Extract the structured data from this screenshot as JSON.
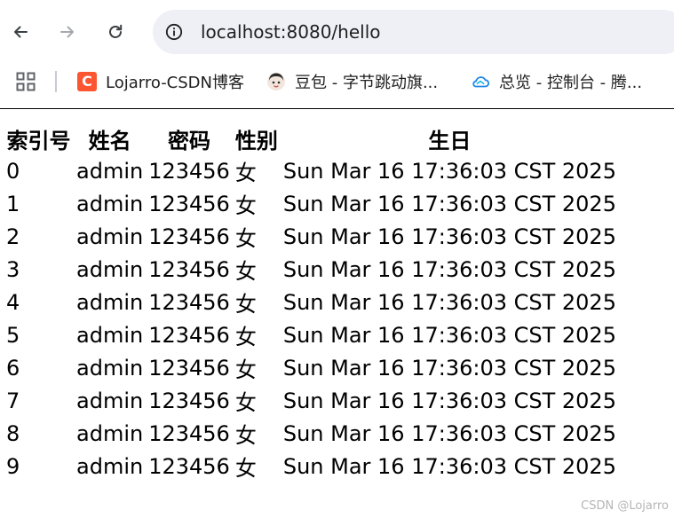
{
  "toolbar": {
    "back_icon": "arrow-left-icon",
    "forward_icon": "arrow-right-icon",
    "reload_icon": "reload-icon",
    "site_info_icon": "info-icon",
    "url": "localhost:8080/hello"
  },
  "bookmarks": [
    {
      "label": "Lojarro-CSDN博客",
      "icon": "csdn-icon"
    },
    {
      "label": "豆包 - 字节跳动旗...",
      "icon": "doubao-avatar-icon"
    },
    {
      "label": "总览 - 控制台 - 腾...",
      "icon": "tencent-cloud-icon"
    }
  ],
  "table": {
    "headers": [
      "索引号",
      "姓名",
      "密码",
      "性别",
      "生日"
    ],
    "rows": [
      [
        "0",
        "admin",
        "123456",
        "女",
        "Sun Mar 16 17:36:03 CST 2025"
      ],
      [
        "1",
        "admin",
        "123456",
        "女",
        "Sun Mar 16 17:36:03 CST 2025"
      ],
      [
        "2",
        "admin",
        "123456",
        "女",
        "Sun Mar 16 17:36:03 CST 2025"
      ],
      [
        "3",
        "admin",
        "123456",
        "女",
        "Sun Mar 16 17:36:03 CST 2025"
      ],
      [
        "4",
        "admin",
        "123456",
        "女",
        "Sun Mar 16 17:36:03 CST 2025"
      ],
      [
        "5",
        "admin",
        "123456",
        "女",
        "Sun Mar 16 17:36:03 CST 2025"
      ],
      [
        "6",
        "admin",
        "123456",
        "女",
        "Sun Mar 16 17:36:03 CST 2025"
      ],
      [
        "7",
        "admin",
        "123456",
        "女",
        "Sun Mar 16 17:36:03 CST 2025"
      ],
      [
        "8",
        "admin",
        "123456",
        "女",
        "Sun Mar 16 17:36:03 CST 2025"
      ],
      [
        "9",
        "admin",
        "123456",
        "女",
        "Sun Mar 16 17:36:03 CST 2025"
      ]
    ]
  },
  "watermark": "CSDN @Lojarro",
  "colors": {
    "omnibox_bg": "#eef0f6",
    "csdn_brand": "#fc5531",
    "cloud_blue": "#1e88e5"
  }
}
